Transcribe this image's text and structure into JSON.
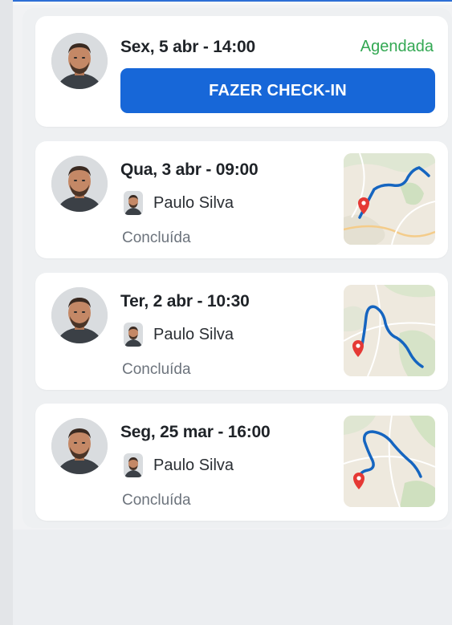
{
  "appointments": [
    {
      "date": "Sex, 5 abr - 14:00",
      "status": "Agendada",
      "action_label": "FAZER CHECK-IN"
    },
    {
      "date": "Qua, 3 abr - 09:00",
      "person": "Paulo Silva",
      "status": "Concluída"
    },
    {
      "date": "Ter, 2 abr - 10:30",
      "person": "Paulo Silva",
      "status": "Concluída"
    },
    {
      "date": "Seg, 25 mar - 16:00",
      "person": "Paulo Silva",
      "status": "Concluída"
    }
  ],
  "colors": {
    "accent": "#1767d8",
    "scheduled_status": "#33a853",
    "done_status": "#6c737c",
    "map_pin": "#e53935",
    "route": "#1565c0"
  },
  "icons": {
    "avatar": "person-photo",
    "map": "route-map-thumbnail",
    "pin": "map-pin-icon"
  }
}
